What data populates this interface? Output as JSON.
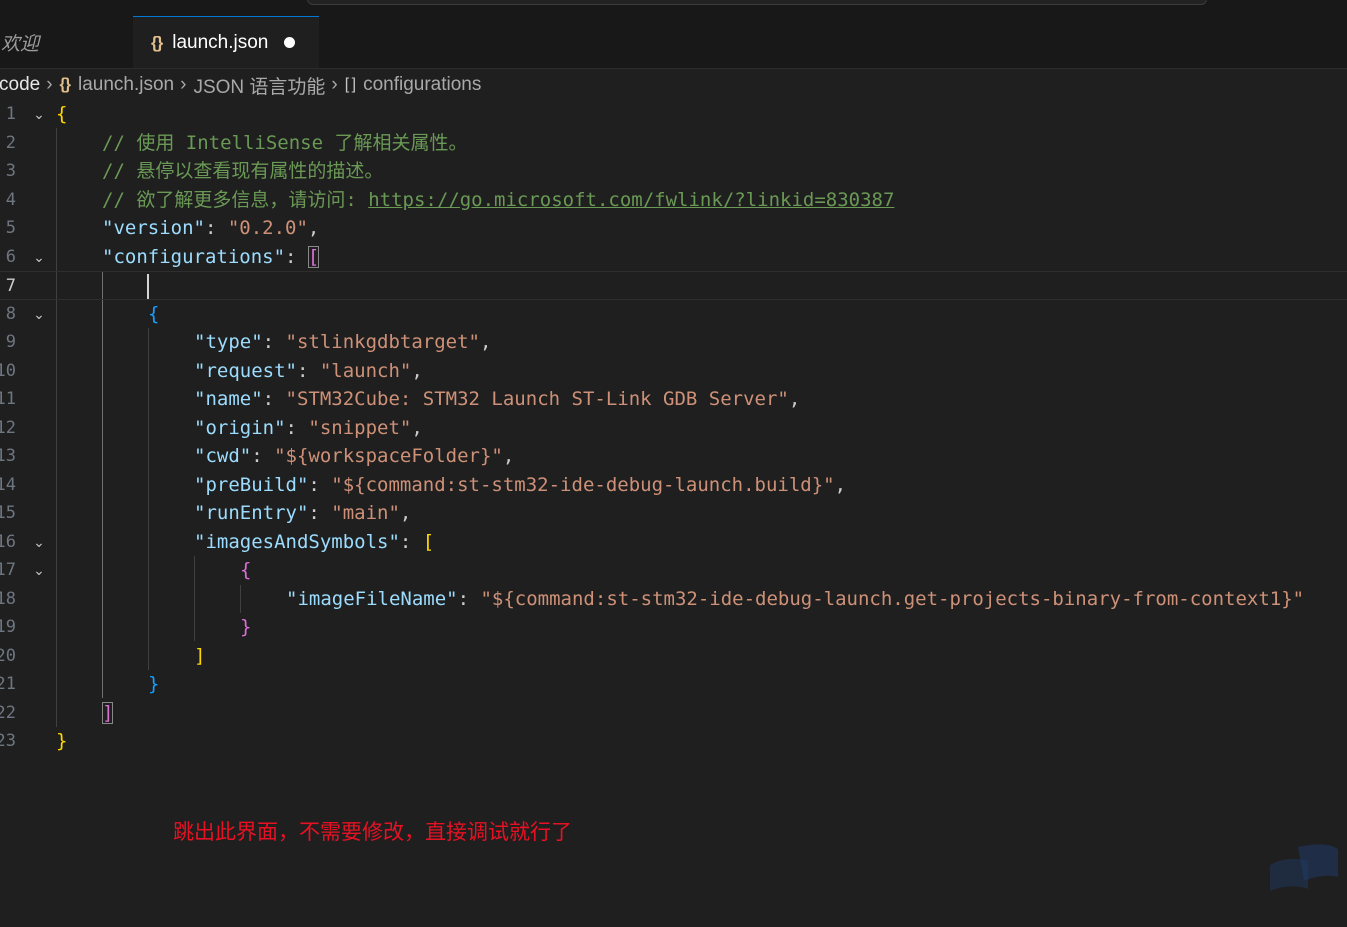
{
  "tabs": [
    {
      "label": "欢迎",
      "active": false
    },
    {
      "label": "launch.json",
      "active": true,
      "modified": true,
      "icon": "json-braces-icon"
    }
  ],
  "breadcrumb": {
    "root": "code",
    "file": "launch.json",
    "section": "JSON 语言功能",
    "symbol": "configurations"
  },
  "editor": {
    "lines": [
      {
        "n": "1",
        "fold": true,
        "indent": 0,
        "tokens": [
          {
            "t": "{",
            "c": "b1"
          }
        ]
      },
      {
        "n": "2",
        "indent": 1,
        "tokens": [
          {
            "t": "// 使用 IntelliSense 了解相关属性。",
            "c": "c"
          }
        ]
      },
      {
        "n": "3",
        "indent": 1,
        "tokens": [
          {
            "t": "// 悬停以查看现有属性的描述。",
            "c": "c"
          }
        ]
      },
      {
        "n": "4",
        "indent": 1,
        "tokens": [
          {
            "t": "// 欲了解更多信息，请访问: ",
            "c": "c"
          },
          {
            "t": "https://go.microsoft.com/fwlink/?linkid=830387",
            "c": "u"
          }
        ]
      },
      {
        "n": "5",
        "indent": 1,
        "tokens": [
          {
            "t": "\"version\"",
            "c": "k"
          },
          {
            "t": ": ",
            "c": "p"
          },
          {
            "t": "\"0.2.0\"",
            "c": "s"
          },
          {
            "t": ",",
            "c": "p"
          }
        ]
      },
      {
        "n": "6",
        "fold": true,
        "indent": 1,
        "tokens": [
          {
            "t": "\"configurations\"",
            "c": "k"
          },
          {
            "t": ": ",
            "c": "p"
          },
          {
            "t": "[",
            "c": "b2 match"
          }
        ]
      },
      {
        "n": "7",
        "current": true,
        "indent": 2,
        "tokens": []
      },
      {
        "n": "8",
        "fold": true,
        "indent": 2,
        "tokens": [
          {
            "t": "{",
            "c": "b3"
          }
        ]
      },
      {
        "n": "9",
        "indent": 3,
        "tokens": [
          {
            "t": "\"type\"",
            "c": "k"
          },
          {
            "t": ": ",
            "c": "p"
          },
          {
            "t": "\"stlinkgdbtarget\"",
            "c": "s"
          },
          {
            "t": ",",
            "c": "p"
          }
        ]
      },
      {
        "n": "10",
        "indent": 3,
        "tokens": [
          {
            "t": "\"request\"",
            "c": "k"
          },
          {
            "t": ": ",
            "c": "p"
          },
          {
            "t": "\"launch\"",
            "c": "s"
          },
          {
            "t": ",",
            "c": "p"
          }
        ]
      },
      {
        "n": "11",
        "indent": 3,
        "tokens": [
          {
            "t": "\"name\"",
            "c": "k"
          },
          {
            "t": ": ",
            "c": "p"
          },
          {
            "t": "\"STM32Cube: STM32 Launch ST-Link GDB Server\"",
            "c": "s"
          },
          {
            "t": ",",
            "c": "p"
          }
        ]
      },
      {
        "n": "12",
        "indent": 3,
        "tokens": [
          {
            "t": "\"origin\"",
            "c": "k"
          },
          {
            "t": ": ",
            "c": "p"
          },
          {
            "t": "\"snippet\"",
            "c": "s"
          },
          {
            "t": ",",
            "c": "p"
          }
        ]
      },
      {
        "n": "13",
        "indent": 3,
        "tokens": [
          {
            "t": "\"cwd\"",
            "c": "k"
          },
          {
            "t": ": ",
            "c": "p"
          },
          {
            "t": "\"${workspaceFolder}\"",
            "c": "s"
          },
          {
            "t": ",",
            "c": "p"
          }
        ]
      },
      {
        "n": "14",
        "indent": 3,
        "tokens": [
          {
            "t": "\"preBuild\"",
            "c": "k"
          },
          {
            "t": ": ",
            "c": "p"
          },
          {
            "t": "\"${command:st-stm32-ide-debug-launch.build}\"",
            "c": "s"
          },
          {
            "t": ",",
            "c": "p"
          }
        ]
      },
      {
        "n": "15",
        "indent": 3,
        "tokens": [
          {
            "t": "\"runEntry\"",
            "c": "k"
          },
          {
            "t": ": ",
            "c": "p"
          },
          {
            "t": "\"main\"",
            "c": "s"
          },
          {
            "t": ",",
            "c": "p"
          }
        ]
      },
      {
        "n": "16",
        "fold": true,
        "indent": 3,
        "tokens": [
          {
            "t": "\"imagesAndSymbols\"",
            "c": "k"
          },
          {
            "t": ": ",
            "c": "p"
          },
          {
            "t": "[",
            "c": "b1"
          }
        ]
      },
      {
        "n": "17",
        "fold": true,
        "indent": 4,
        "tokens": [
          {
            "t": "{",
            "c": "b2"
          }
        ]
      },
      {
        "n": "18",
        "indent": 5,
        "tokens": [
          {
            "t": "\"imageFileName\"",
            "c": "k"
          },
          {
            "t": ": ",
            "c": "p"
          },
          {
            "t": "\"${command:st-stm32-ide-debug-launch.get-projects-binary-from-context1}\"",
            "c": "s"
          }
        ]
      },
      {
        "n": "19",
        "indent": 4,
        "tokens": [
          {
            "t": "}",
            "c": "b2"
          }
        ]
      },
      {
        "n": "20",
        "indent": 3,
        "tokens": [
          {
            "t": "]",
            "c": "b1"
          }
        ]
      },
      {
        "n": "21",
        "indent": 2,
        "tokens": [
          {
            "t": "}",
            "c": "b3"
          }
        ]
      },
      {
        "n": "22",
        "indent": 1,
        "tokens": [
          {
            "t": "]",
            "c": "b2 match"
          }
        ]
      },
      {
        "n": "23",
        "indent": 0,
        "tokens": [
          {
            "t": "}",
            "c": "b1"
          }
        ]
      }
    ]
  },
  "annotation": {
    "text": "跳出此界面，不需要修改，直接调试就行了",
    "color": "#e81123"
  },
  "colors": {
    "editor_bg": "#1f1f1f",
    "tabbar_bg": "#181818",
    "accent": "#0078d4"
  }
}
